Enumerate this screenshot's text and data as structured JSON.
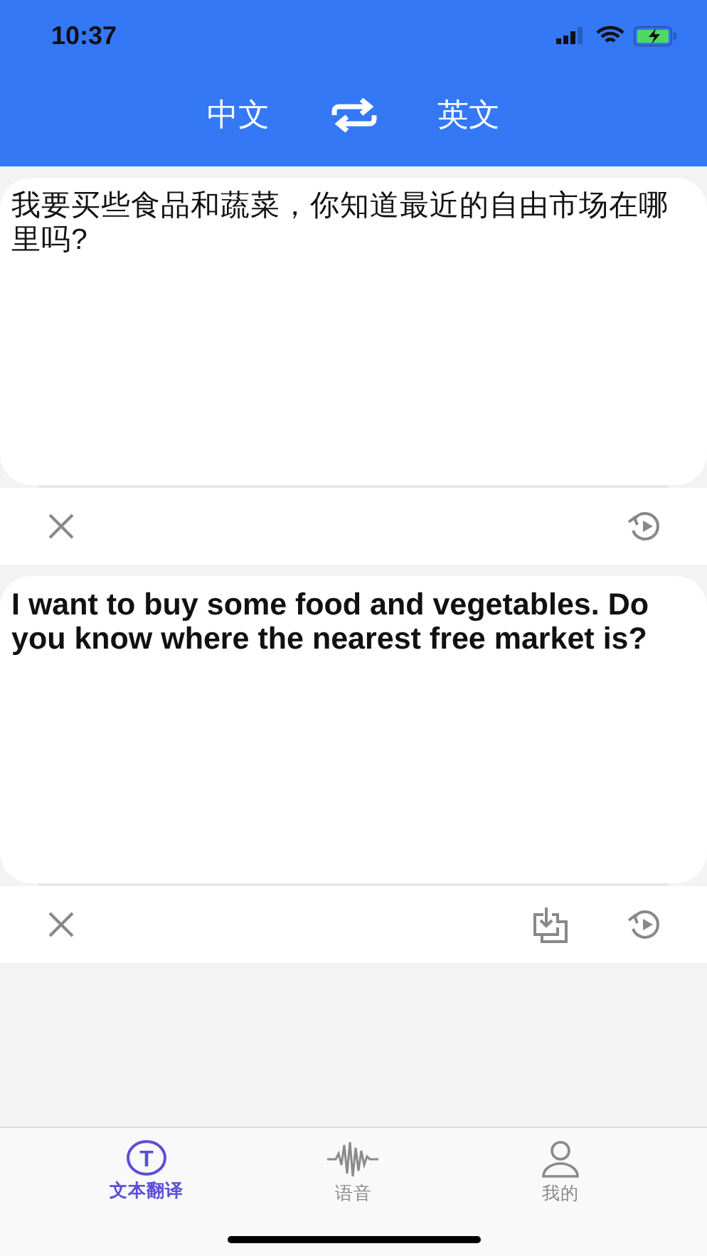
{
  "status_bar": {
    "time": "10:37"
  },
  "header": {
    "source_language": "中文",
    "target_language": "英文"
  },
  "panels": [
    {
      "kind": "source",
      "text": "我要买些食品和蔬菜，你知道最近的自由市场在哪里吗?",
      "actions": [
        {
          "kind": "clear"
        },
        {
          "kind": "replay"
        }
      ]
    },
    {
      "kind": "target",
      "text": "I want to buy some food and vegetables. Do you know where the nearest free market is?",
      "actions": [
        {
          "kind": "clear"
        },
        {
          "kind": "save"
        },
        {
          "kind": "replay"
        }
      ]
    }
  ],
  "tab_bar": [
    {
      "kind": "text",
      "label": "文本翻译",
      "icon_letter": "T",
      "selected": true
    },
    {
      "kind": "voice",
      "label": "语音",
      "selected": false
    },
    {
      "kind": "profile",
      "label": "我的",
      "selected": false
    }
  ]
}
